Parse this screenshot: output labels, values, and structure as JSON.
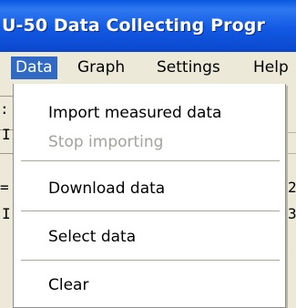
{
  "window": {
    "title": "U-50 Data Collecting Progr"
  },
  "menubar": {
    "items": [
      {
        "label": "Data"
      },
      {
        "label": "Graph"
      },
      {
        "label": "Settings"
      },
      {
        "label": "Help"
      }
    ]
  },
  "data_menu": {
    "items": [
      {
        "label": "Import measured data",
        "enabled": true
      },
      {
        "label": "Stop importing",
        "enabled": false
      },
      {
        "label": "Download data",
        "enabled": true
      },
      {
        "label": "Select data",
        "enabled": true
      },
      {
        "label": "Clear",
        "enabled": true
      }
    ]
  },
  "background_fragments": {
    "a": ":",
    "b": "I",
    "c": "=",
    "d": "I",
    "e": "2",
    "f": "3"
  },
  "colors": {
    "titlebar": "#0a58e0",
    "menu_highlight": "#316ac5",
    "disabled_text": "#a3a39c"
  }
}
